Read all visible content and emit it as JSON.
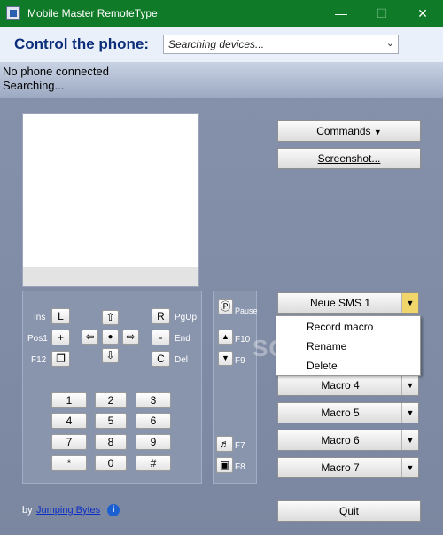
{
  "window": {
    "title": "Mobile Master RemoteType",
    "min": "—",
    "max": "☐",
    "close": "✕"
  },
  "header": {
    "label": "Control the phone:",
    "device_select": "Searching devices...",
    "arrow": "⌄"
  },
  "status": {
    "line1": "No phone connected",
    "line2": "Searching..."
  },
  "nav": {
    "labels": {
      "ins": "Ins",
      "pos1": "Pos1",
      "f12": "F12",
      "pgup": "PgUp",
      "end": "End",
      "del": "Del"
    },
    "keys": {
      "l": "L",
      "plus": "+",
      "copy": "❐",
      "r": "R",
      "minus": "-",
      "c": "C",
      "up": "⇧",
      "left": "⇦",
      "center": "●",
      "right": "⇨",
      "down": "⇩"
    }
  },
  "numpad": [
    "1",
    "2",
    "3",
    "4",
    "5",
    "6",
    "7",
    "8",
    "9",
    "*",
    "0",
    "#"
  ],
  "fkeys": {
    "pause": "Pause",
    "f10": "F10",
    "f9": "F9",
    "f7": "F7",
    "f8": "F8",
    "pause_icon": "Ⓟ",
    "up_icon": "▲",
    "down_icon": "▼",
    "music_icon": "♬",
    "film_icon": "▣"
  },
  "buttons": {
    "commands": "Commands",
    "commands_arrow": "▼",
    "screenshot": "Screenshot...",
    "quit": "Quit"
  },
  "macros": [
    {
      "label": "Neue SMS 1",
      "active": true
    },
    {
      "label": "Macro 4"
    },
    {
      "label": "Macro 5"
    },
    {
      "label": "Macro 6"
    },
    {
      "label": "Macro 7"
    }
  ],
  "dropdown_arrow": "▼",
  "context_menu": [
    "Record macro",
    "Rename",
    "Delete"
  ],
  "footer": {
    "by": "by",
    "link": "Jumping Bytes",
    "info_icon": "i"
  },
  "watermark": "SOFTPEDIA",
  "colors": {
    "titlebar": "#0f7a27",
    "header_text": "#0b2d7a",
    "background": "#7f8aa4",
    "accent": "#f0d66a"
  }
}
